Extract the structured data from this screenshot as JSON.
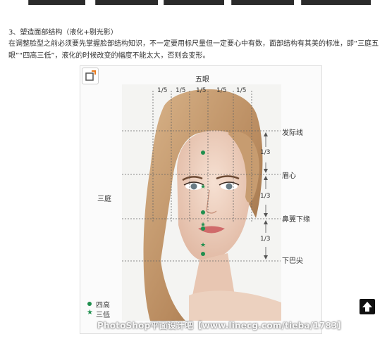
{
  "article": {
    "heading": "3、塑造面部结构（液化+剔光影）",
    "paragraph": "在调整脸型之前必须要先掌握脸部结构知识，不一定要用标尺量但一定要心中有数，面部结构有其美的标准，即“三庭五眼”“四高三低”，液化的时候改变的幅度不能太大，否则会变形。"
  },
  "diagram": {
    "title": "五眼",
    "fifths": [
      "1/5",
      "1/5",
      "1/5",
      "1/5",
      "1/5"
    ],
    "thirds": [
      "1/3",
      "1/3",
      "1/3"
    ],
    "left_label": "三庭",
    "right_labels": [
      "发际线",
      "眉心",
      "鼻翼下缘",
      "下巴尖"
    ],
    "legend": [
      {
        "symbol": "dot",
        "label": "四高"
      },
      {
        "symbol": "star",
        "label": "三低"
      }
    ],
    "marker_color": "#1f8f4e",
    "watermark": "PhotoShop平面设计吧【www.linecg.com/tieba/1783】"
  },
  "icons": {
    "expand": "expand-image-icon",
    "scroll_top": "arrow-up-icon"
  }
}
